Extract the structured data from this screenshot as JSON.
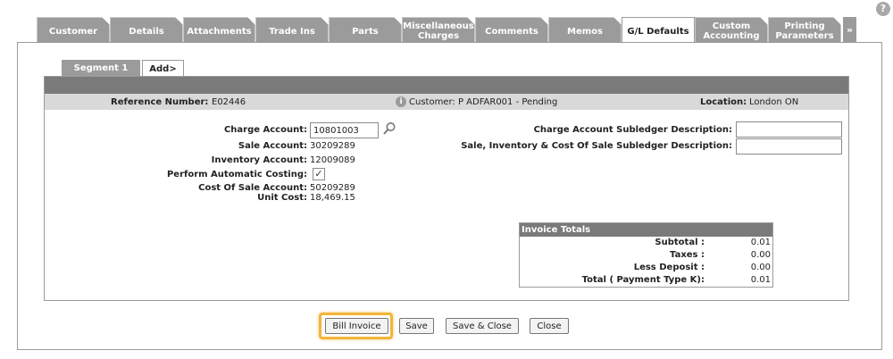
{
  "help": {
    "glyph": "?"
  },
  "tabs": [
    {
      "label": "Customer"
    },
    {
      "label": "Details"
    },
    {
      "label": "Attachments"
    },
    {
      "label": "Trade Ins"
    },
    {
      "label": "Parts"
    },
    {
      "label": "Miscellaneous Charges"
    },
    {
      "label": "Comments"
    },
    {
      "label": "Memos"
    },
    {
      "label": "G/L Defaults"
    },
    {
      "label": "Custom Accounting"
    },
    {
      "label": "Printing Parameters"
    }
  ],
  "tab_more": "»",
  "segments": {
    "active": "Segment 1",
    "add": "Add>"
  },
  "info": {
    "reference_label": "Reference Number:",
    "reference_value": "E02446",
    "customer_text": "Customer: P ADFAR001  -  Pending",
    "location_label": "Location:",
    "location_value": "London ON"
  },
  "form": {
    "charge_account_label": "Charge Account:",
    "charge_account_value": "10801003",
    "sale_account_label": "Sale Account:",
    "sale_account_value": "30209289",
    "inventory_account_label": "Inventory Account:",
    "inventory_account_value": "12009089",
    "auto_costing_label": "Perform Automatic Costing:",
    "auto_costing_checked": true,
    "cost_of_sale_label": "Cost Of Sale Account:",
    "cost_of_sale_value": "50209289",
    "unit_cost_label": "Unit Cost:",
    "unit_cost_value": "18,469.15",
    "charge_subledger_label": "Charge Account Subledger Description:",
    "charge_subledger_value": "",
    "sale_subledger_label": "Sale, Inventory & Cost Of Sale Subledger Description:",
    "sale_subledger_value": ""
  },
  "totals": {
    "header": "Invoice Totals",
    "rows": [
      {
        "label": "Subtotal :",
        "value": "0.01"
      },
      {
        "label": "Taxes :",
        "value": "0.00"
      },
      {
        "label": "Less Deposit :",
        "value": "0.00"
      },
      {
        "label": "Total  ( Payment Type K):",
        "value": "0.01"
      }
    ]
  },
  "buttons": {
    "bill_invoice": "Bill Invoice",
    "save": "Save",
    "save_close": "Save & Close",
    "close": "Close"
  },
  "colors": {
    "tab_gray": "#9b9b9b",
    "dark_bar": "#7a7a7a",
    "highlight": "#f2b53a"
  }
}
